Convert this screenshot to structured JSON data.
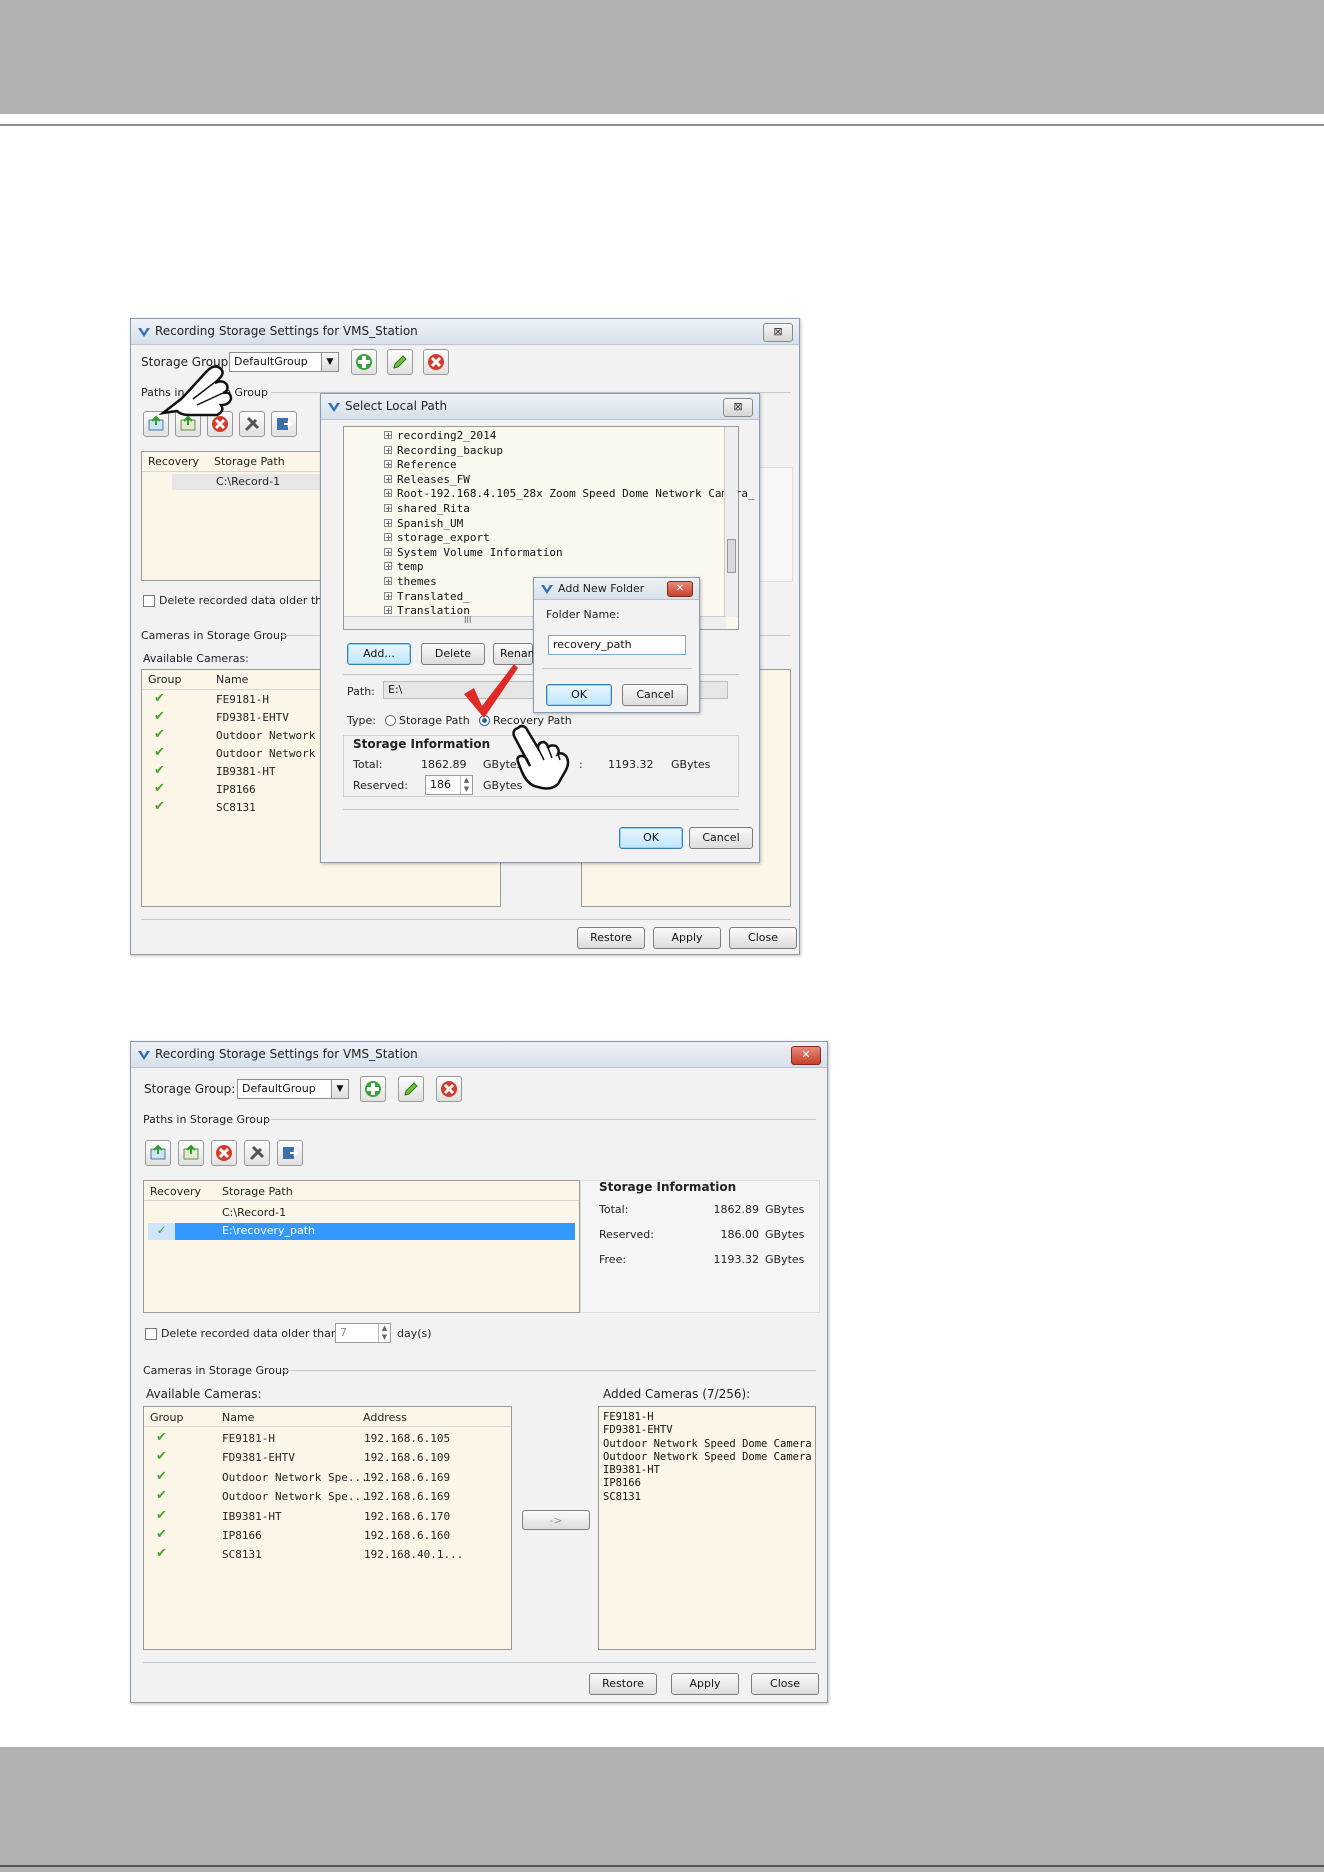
{
  "win1": {
    "title": "Recording Storage Settings for VMS_Station",
    "close": "⊠",
    "storage_group_label": "Storage Group:",
    "storage_group_value": "DefaultGroup",
    "paths_label": "Paths in Storage Group",
    "table_headers": [
      "Recovery",
      "Storage Path"
    ],
    "rows": [
      {
        "path": "C:\\Record-1"
      }
    ],
    "right_units": [
      "ytes",
      "ytes",
      "ytes"
    ],
    "delete_label": "Delete recorded data older than",
    "cameras_label": "Cameras in Storage Group",
    "available_label": "Available Cameras:",
    "cam_headers": [
      "Group",
      "Name"
    ],
    "cams": [
      "FE9181-H",
      "FD9381-EHTV",
      "Outdoor Network Sp",
      "Outdoor Network Sp",
      "IB9381-HT",
      "IP8166",
      "SC8131"
    ],
    "right_cams": [
      "nera",
      "nera"
    ],
    "buttons": {
      "restore": "Restore",
      "apply": "Apply",
      "close": "Close"
    }
  },
  "dialog": {
    "title": "Select Local Path",
    "close": "⊠",
    "folders": [
      "recording2_2014",
      "Recording_backup",
      "Reference",
      "Releases_FW",
      "Root-192.168.4.105_28x Zoom Speed Dome Network Camera_",
      "shared_Rita",
      "Spanish_UM",
      "storage_export",
      "System Volume Information",
      "temp",
      "themes",
      "Translated_",
      "Translation"
    ],
    "scroll_mid": "lll",
    "add": "Add...",
    "delete": "Delete",
    "rename": "Renam",
    "path_label": "Path:",
    "path_value": "E:\\",
    "type_label": "Type:",
    "type_storage": "Storage Path",
    "type_recovery": "Recovery Path",
    "info_title": "Storage Information",
    "total_label": "Total:",
    "total_value": "1862.89",
    "unit": "GBytes",
    "free_label": ":",
    "free_value": "1193.32",
    "reserved_label": "Reserved:",
    "reserved_value": "186",
    "ok": "OK",
    "cancel": "Cancel"
  },
  "addfolder": {
    "title": "Add New Folder",
    "close": "✕",
    "name_label": "Folder Name:",
    "name_value": "recovery_path",
    "ok": "OK",
    "cancel": "Cancel"
  },
  "win2": {
    "title": "Recording Storage Settings for VMS_Station",
    "close": "✕",
    "storage_group_label": "Storage Group:",
    "storage_group_value": "DefaultGroup",
    "paths_label": "Paths in Storage Group",
    "table_headers": [
      "Recovery",
      "Storage Path"
    ],
    "rows": [
      {
        "recovery": "",
        "path": "C:\\Record-1"
      },
      {
        "recovery": "✓",
        "path": "E:\\recovery_path"
      }
    ],
    "info": {
      "title": "Storage Information",
      "total_label": "Total:",
      "total": "1862.89",
      "reserved_label": "Reserved:",
      "reserved": "186.00",
      "free_label": "Free:",
      "free": "1193.32",
      "unit": "GBytes"
    },
    "delete_label": "Delete recorded data older than",
    "days_value": "7",
    "days_unit": "day(s)",
    "cameras_label": "Cameras in Storage Group",
    "available_label": "Available Cameras:",
    "added_label": "Added Cameras  (7/256):",
    "cam_headers": [
      "Group",
      "Name",
      "Address"
    ],
    "cams": [
      {
        "name": "FE9181-H",
        "addr": "192.168.6.105"
      },
      {
        "name": "FD9381-EHTV",
        "addr": "192.168.6.109"
      },
      {
        "name": "Outdoor Network Spe...",
        "addr": "192.168.6.169"
      },
      {
        "name": "Outdoor Network Spe...",
        "addr": "192.168.6.169"
      },
      {
        "name": "IB9381-HT",
        "addr": "192.168.6.170"
      },
      {
        "name": "IP8166",
        "addr": "192.168.6.160"
      },
      {
        "name": "SC8131",
        "addr": "192.168.40.1..."
      }
    ],
    "added": [
      "FE9181-H",
      "FD9381-EHTV",
      "Outdoor Network Speed Dome Camera",
      "Outdoor Network Speed Dome Camera",
      "IB9381-HT",
      "IP8166",
      "SC8131"
    ],
    "move_button": "->",
    "buttons": {
      "restore": "Restore",
      "apply": "Apply",
      "close": "Close"
    }
  }
}
